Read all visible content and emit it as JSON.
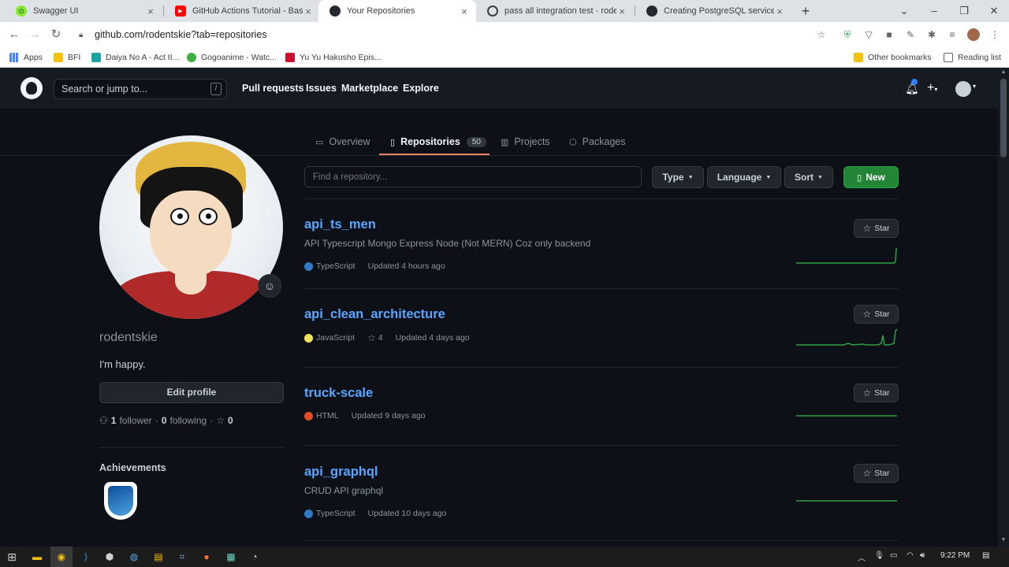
{
  "browser": {
    "tabs": [
      {
        "title": "Swagger UI",
        "color": "#85ea2d",
        "glyph": "⊙"
      },
      {
        "title": "GitHub Actions Tutorial - Basic C",
        "color": "#ff0000",
        "glyph": "▶"
      },
      {
        "title": "Your Repositories",
        "color": "#24292f",
        "glyph": "●"
      },
      {
        "title": "pass all integration test · rodents",
        "color": "#3c4043",
        "glyph": "◌"
      },
      {
        "title": "Creating PostgreSQL service con",
        "color": "#24292f",
        "glyph": "●"
      }
    ],
    "new_tab": "+",
    "url": "github.com/rodentskie?tab=repositories",
    "bookmarks": [
      {
        "label": "Apps",
        "color": "#4285f4"
      },
      {
        "label": "BFI",
        "color": "#f4c20d"
      },
      {
        "label": "Daiya No A - Act II...",
        "color": "#1aa1a1"
      },
      {
        "label": "Gogoanime - Watc...",
        "color": "#3cb043"
      },
      {
        "label": "Yu Yu Hakusho Epis...",
        "color": "#c8102e"
      },
      {
        "label": "Other bookmarks",
        "color": "#f4c20d"
      },
      {
        "label": "Reading list",
        "color": "#5f6368"
      }
    ]
  },
  "github": {
    "search_placeholder": "Search or jump to...",
    "search_key": "/",
    "nav": [
      "Pull requests",
      "Issues",
      "Marketplace",
      "Explore"
    ]
  },
  "profile_tabs": [
    {
      "label": "Overview",
      "icon": "book-icon"
    },
    {
      "label": "Repositories",
      "icon": "repo-icon",
      "count": "50"
    },
    {
      "label": "Projects",
      "icon": "project-icon"
    },
    {
      "label": "Packages",
      "icon": "package-icon"
    }
  ],
  "profile": {
    "username": "rodentskie",
    "bio": "I'm happy.",
    "edit_label": "Edit profile",
    "followers": "1",
    "followers_label": "follower",
    "following": "0",
    "following_label": "following",
    "stars": "0",
    "achievements_title": "Achievements"
  },
  "toolbar": {
    "find_placeholder": "Find a repository...",
    "type_label": "Type",
    "language_label": "Language",
    "sort_label": "Sort",
    "new_label": "New"
  },
  "repos": [
    {
      "name": "api_ts_men",
      "description": "API Typescript Mongo Express Node (Not MERN) Coz only backend",
      "language": "TypeScript",
      "lang_color": "#3178c6",
      "stars": "",
      "updated": "Updated 4 hours ago",
      "star_label": "Star"
    },
    {
      "name": "api_clean_architecture",
      "description": "",
      "language": "JavaScript",
      "lang_color": "#f1e05a",
      "stars": "4",
      "updated": "Updated 4 days ago",
      "star_label": "Star"
    },
    {
      "name": "truck-scale",
      "description": "",
      "language": "HTML",
      "lang_color": "#e34c26",
      "stars": "",
      "updated": "Updated 9 days ago",
      "star_label": "Star"
    },
    {
      "name": "api_graphql",
      "description": "CRUD API graphql",
      "language": "TypeScript",
      "lang_color": "#3178c6",
      "stars": "",
      "updated": "Updated 10 days ago",
      "star_label": "Star"
    }
  ],
  "taskbar": {
    "time": "9:22 PM"
  },
  "colors": {
    "link": "#58a6ff",
    "accent_underline": "#f78166",
    "new_button": "#238636",
    "sparkline": "#2ea043"
  }
}
